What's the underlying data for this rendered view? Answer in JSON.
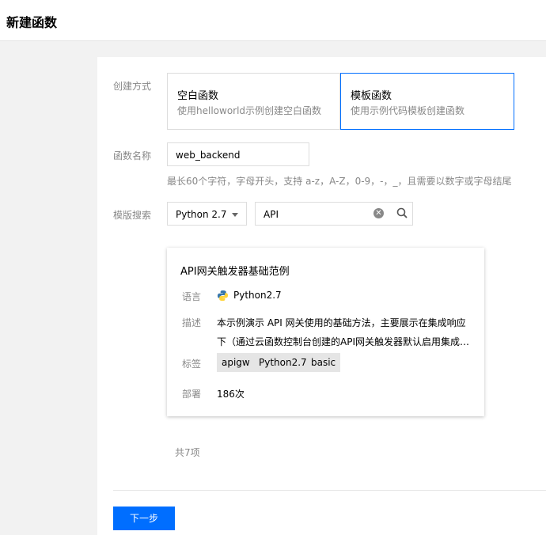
{
  "header": {
    "title": "新建函数"
  },
  "form": {
    "create_method_label": "创建方式",
    "options": [
      {
        "title": "空白函数",
        "desc": "使用helloworld示例创建空白函数"
      },
      {
        "title": "模板函数",
        "desc": "使用示例代码模板创建函数"
      }
    ],
    "function_name_label": "函数名称",
    "function_name_value": "web_backend",
    "function_name_hint": "最长60个字符，字母开头，支持 a-z，A-Z，0-9，-，_，且需要以数字或字母结尾",
    "template_search_label": "模版搜索",
    "runtime_value": "Python 2.7",
    "search_value": "API"
  },
  "template_card": {
    "title": "API网关触发器基础范例",
    "language_label": "语言",
    "language_value": "Python2.7",
    "desc_label": "描述",
    "desc_line1": "本示例演示 API 网关使用的基础方法，主要展示在集成响应",
    "desc_line2": "下（通过云函数控制台创建的API网关触发器默认启用集成…",
    "tags_label": "标签",
    "tags": [
      "apigw",
      "Python2.7",
      "basic"
    ],
    "deploy_label": "部署",
    "deploy_value": "186次"
  },
  "total_text": "共7项",
  "next_button": "下一步",
  "colors": {
    "accent": "#006eff",
    "muted": "#888888"
  }
}
